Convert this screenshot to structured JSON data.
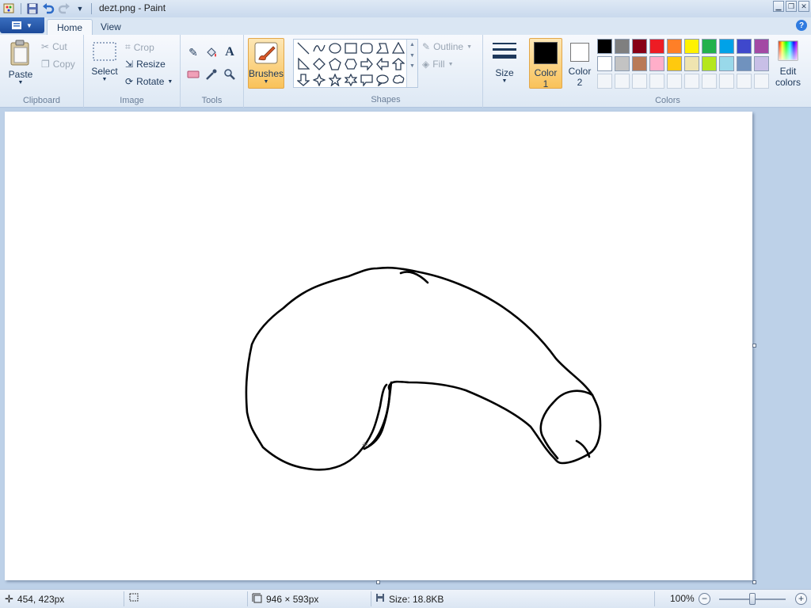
{
  "window": {
    "title": "dezt.png - Paint"
  },
  "tabs": [
    {
      "label": "Home"
    },
    {
      "label": "View"
    }
  ],
  "ribbon": {
    "clipboard": {
      "paste": "Paste",
      "cut": "Cut",
      "copy": "Copy",
      "label": "Clipboard"
    },
    "image": {
      "select": "Select",
      "crop": "Crop",
      "resize": "Resize",
      "rotate": "Rotate",
      "label": "Image"
    },
    "tools": {
      "label": "Tools"
    },
    "brushes": {
      "label": "Brushes"
    },
    "shapes": {
      "outline": "Outline",
      "fill": "Fill",
      "label": "Shapes"
    },
    "size": {
      "label": "Size"
    },
    "colors": {
      "color1_line1": "Color",
      "color1_line2": "1",
      "color2_line1": "Color",
      "color2_line2": "2",
      "edit_line1": "Edit",
      "edit_line2": "colors",
      "label": "Colors",
      "color1_value": "#000000",
      "color2_value": "#ffffff",
      "palette_row1": [
        "#000000",
        "#7f7f7f",
        "#880015",
        "#ed1c24",
        "#ff7f27",
        "#fff200",
        "#22b14c",
        "#00a2e8",
        "#3f48cc",
        "#a349a4"
      ],
      "palette_row2": [
        "#ffffff",
        "#c3c3c3",
        "#b97a57",
        "#ffaec9",
        "#ffc90e",
        "#efe4b0",
        "#b5e61d",
        "#99d9ea",
        "#7092be",
        "#c8bfe7"
      ]
    }
  },
  "status": {
    "cursor_pos": "454, 423px",
    "image_size": "946 × 593px",
    "file_size": "Size: 18.8KB",
    "zoom": "100%"
  }
}
